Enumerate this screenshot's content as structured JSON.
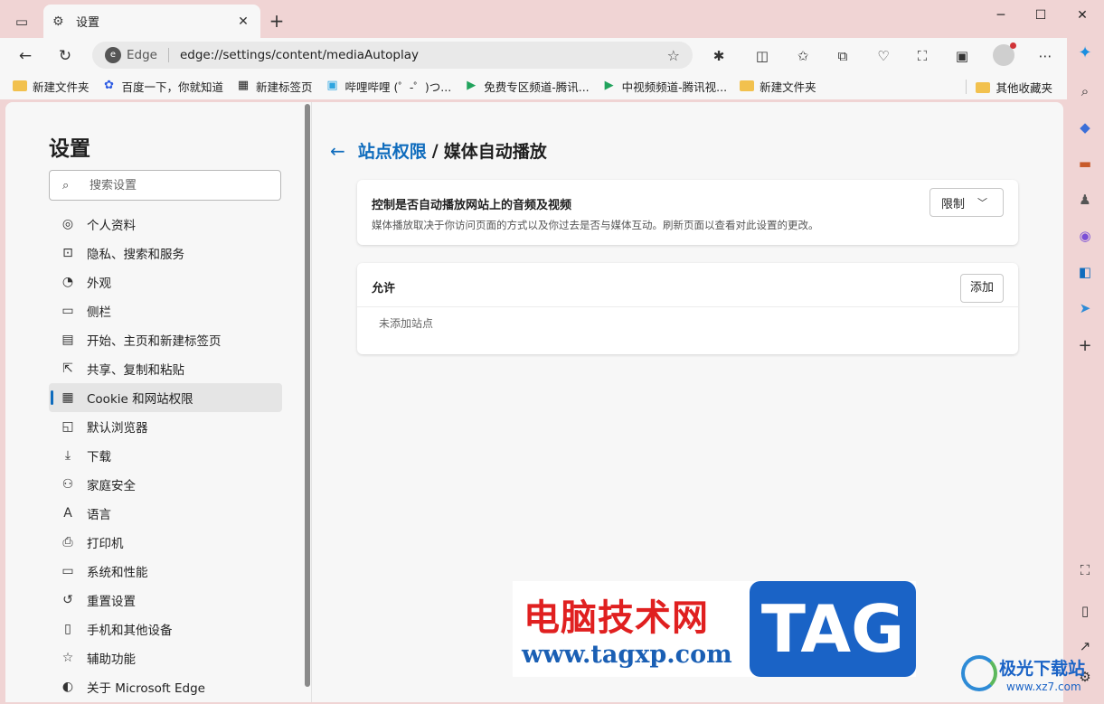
{
  "tab": {
    "title": "设置"
  },
  "address": {
    "site_name": "Edge",
    "url": "edge://settings/content/mediaAutoplay"
  },
  "bookmarks": [
    {
      "label": "新建文件夹",
      "icon": "folder-icon"
    },
    {
      "label": "百度一下，你就知道",
      "icon": "baidu-icon"
    },
    {
      "label": "新建标签页",
      "icon": "newtab-icon"
    },
    {
      "label": "哔哩哔哩 (゜-゜)つ...",
      "icon": "bilibili-icon"
    },
    {
      "label": "免费专区频道-腾讯...",
      "icon": "tencent-video-icon"
    },
    {
      "label": "中视频频道-腾讯视...",
      "icon": "tencent-video-icon"
    },
    {
      "label": "新建文件夹",
      "icon": "folder-icon"
    }
  ],
  "bookmarks_other": "其他收藏夹",
  "sidebar": {
    "title": "设置",
    "search_placeholder": "搜索设置",
    "items": [
      {
        "label": "个人资料",
        "icon": "profile-icon"
      },
      {
        "label": "隐私、搜索和服务",
        "icon": "lock-icon"
      },
      {
        "label": "外观",
        "icon": "palette-icon"
      },
      {
        "label": "侧栏",
        "icon": "sidebar-icon"
      },
      {
        "label": "开始、主页和新建标签页",
        "icon": "home-tab-icon"
      },
      {
        "label": "共享、复制和粘贴",
        "icon": "share-icon"
      },
      {
        "label": "Cookie 和网站权限",
        "icon": "site-permissions-icon",
        "active": true
      },
      {
        "label": "默认浏览器",
        "icon": "browser-icon"
      },
      {
        "label": "下载",
        "icon": "download-icon"
      },
      {
        "label": "家庭安全",
        "icon": "family-icon"
      },
      {
        "label": "语言",
        "icon": "language-icon"
      },
      {
        "label": "打印机",
        "icon": "printer-icon"
      },
      {
        "label": "系统和性能",
        "icon": "laptop-icon"
      },
      {
        "label": "重置设置",
        "icon": "reset-icon"
      },
      {
        "label": "手机和其他设备",
        "icon": "phone-icon"
      },
      {
        "label": "辅助功能",
        "icon": "accessibility-icon"
      },
      {
        "label": "关于 Microsoft Edge",
        "icon": "edge-icon"
      }
    ]
  },
  "main": {
    "breadcrumb_link": "站点权限",
    "breadcrumb_separator": "/",
    "breadcrumb_current": "媒体自动播放",
    "autoplay": {
      "title": "控制是否自动播放网站上的音频及视频",
      "description": "媒体播放取决于你访问页面的方式以及你过去是否与媒体互动。刷新页面以查看对此设置的更改。",
      "selected": "限制"
    },
    "allow": {
      "title": "允许",
      "add_label": "添加",
      "empty_text": "未添加站点"
    }
  },
  "watermark": {
    "cn_text": "电脑技术网",
    "url": "www.tagxp.com",
    "tag": "TAG",
    "site2_name": "极光下载站",
    "site2_url": "www.xz7.com"
  },
  "colors": {
    "accent": "#0f6cbd",
    "frame": "#f0d4d4",
    "page_bg": "#f7f7f7"
  }
}
